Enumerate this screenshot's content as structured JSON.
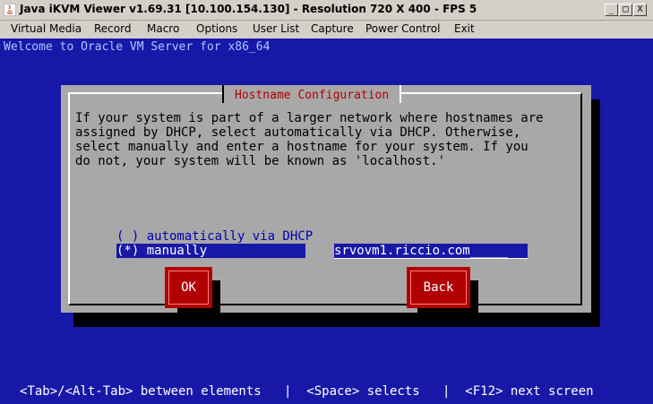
{
  "window": {
    "title": "Java iKVM Viewer v1.69.31 [10.100.154.130]  - Resolution 720 X 400 - FPS 5",
    "controls": {
      "minimize": "_",
      "maximize": "□",
      "close": "X"
    }
  },
  "menu": [
    {
      "label": "Virtual Media"
    },
    {
      "label": "Record"
    },
    {
      "label": "Macro"
    },
    {
      "label": "Options"
    },
    {
      "label": "User List"
    },
    {
      "label": "Capture"
    },
    {
      "label": "Power Control"
    },
    {
      "label": "Exit"
    }
  ],
  "console": {
    "welcome": "Welcome to Oracle VM Server for x86_64",
    "dialog": {
      "title": "Hostname Configuration",
      "body": "If your system is part of a larger network where hostnames are\nassigned by DHCP, select automatically via DHCP. Otherwise,\nselect manually and enter a hostname for your system. If you\ndo not, your system will be known as 'localhost.'",
      "radio_dhcp": "( ) automatically via DHCP",
      "radio_manual": "(*) manually             ",
      "hostname_value": "srvovm1.riccio.com_____",
      "ok_label": "OK",
      "back_label": "Back"
    },
    "status_line": "<Tab>/<Alt-Tab> between elements   |  <Space> selects   |  <F12> next screen"
  },
  "colors": {
    "console_bg": "#1818a8",
    "dialog_bg": "#a8a8a8",
    "title_red": "#b00000",
    "button_red": "#b00000"
  }
}
